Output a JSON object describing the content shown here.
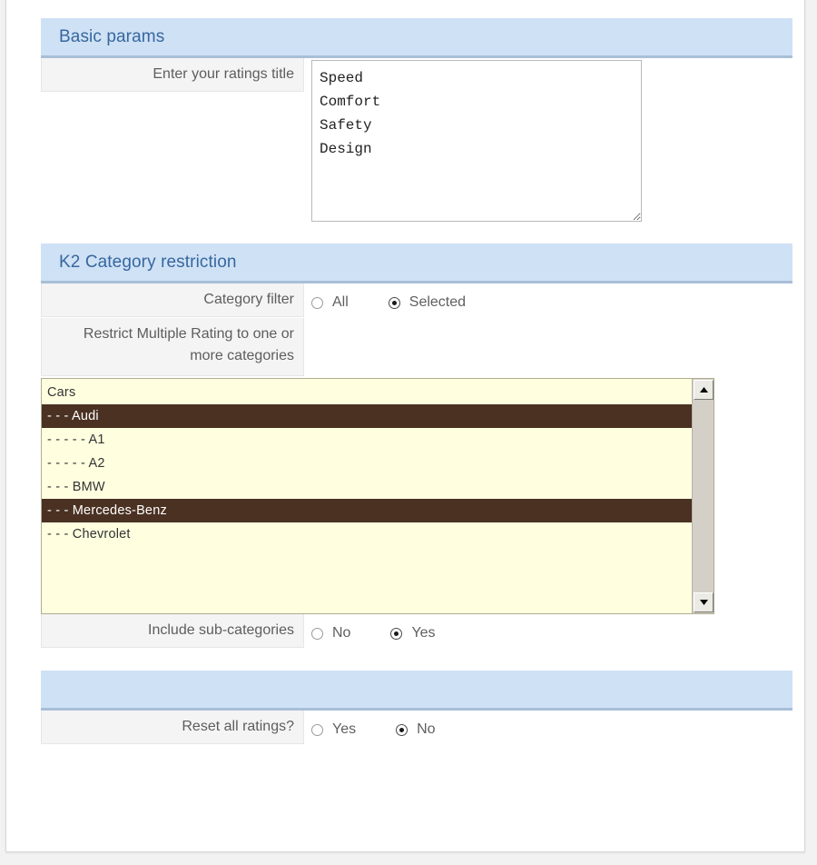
{
  "sections": [
    {
      "id": "basic-params",
      "title": "Basic params",
      "rows": [
        {
          "id": "ratings-title",
          "label": "Enter your ratings title",
          "type": "textarea",
          "value": "Speed\nComfort\nSafety\nDesign",
          "placeholder": ""
        }
      ]
    },
    {
      "id": "k2-category-restriction",
      "title": "K2 Category restriction",
      "rows": [
        {
          "id": "category-filter",
          "label": "Category filter",
          "type": "radio",
          "options": [
            {
              "label": "All",
              "checked": false
            },
            {
              "label": "Selected",
              "checked": true
            }
          ]
        },
        {
          "id": "restrict-categories",
          "label": "Restrict Multiple Rating to one or more categories",
          "type": "listbox"
        },
        {
          "id": "include-subcategories",
          "label": "Include sub-categories",
          "type": "radio",
          "options": [
            {
              "label": "No",
              "checked": false
            },
            {
              "label": "Yes",
              "checked": true
            }
          ]
        }
      ]
    },
    {
      "id": "reset-section",
      "title": "",
      "rows": [
        {
          "id": "reset-all-ratings",
          "label": "Reset all ratings?",
          "type": "radio",
          "options": [
            {
              "label": "Yes",
              "checked": false
            },
            {
              "label": "No",
              "checked": true
            }
          ]
        }
      ]
    }
  ],
  "category_list": {
    "items": [
      {
        "label": "Cars",
        "selected": false
      },
      {
        "label": "- - - Audi",
        "selected": true
      },
      {
        "label": "- - - - - A1",
        "selected": false
      },
      {
        "label": "- - - - - A2",
        "selected": false
      },
      {
        "label": "- - - BMW",
        "selected": false
      },
      {
        "label": "- - - Mercedes-Benz",
        "selected": true
      },
      {
        "label": "- - - Chevrolet",
        "selected": false
      }
    ],
    "scroll_up_icon": "triangle-up-icon",
    "scroll_down_icon": "triangle-down-icon"
  },
  "colors": {
    "header_bg": "#cfe1f5",
    "header_border": "#a8bfd8",
    "header_text": "#36679f",
    "label_bg": "#f4f4f4",
    "label_text": "#5d5d5d",
    "list_bg": "#ffffe0",
    "list_selected_bg": "#4a3122",
    "list_selected_text": "#ffffff",
    "page_bg": "#f2f2f2"
  }
}
